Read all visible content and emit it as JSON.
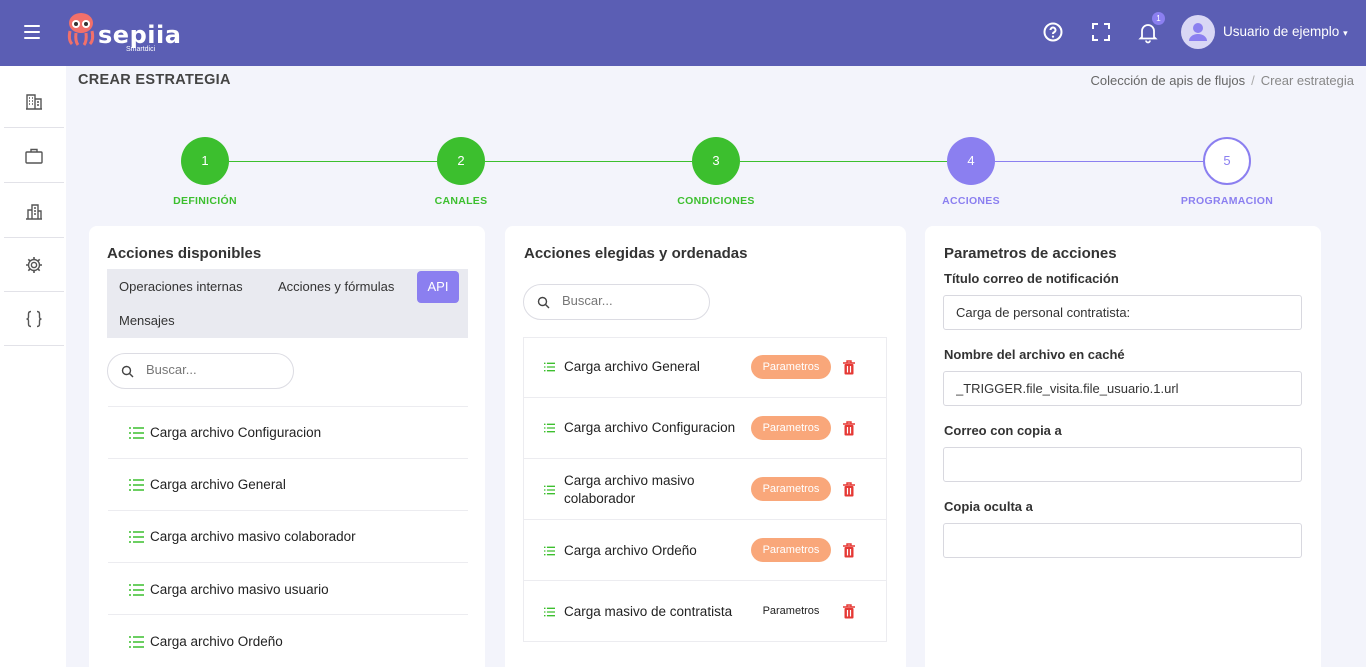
{
  "header": {
    "logo_text": "sepiia",
    "logo_subtext": "Smartdici",
    "notification_count": "1",
    "user_name": "Usuario de ejemplo"
  },
  "sidebar": {
    "items": [
      {
        "icon": "building-icon"
      },
      {
        "icon": "briefcase-icon"
      },
      {
        "icon": "city-icon"
      },
      {
        "icon": "gear-icon"
      },
      {
        "icon": "braces-icon"
      }
    ]
  },
  "page": {
    "title": "CREAR ESTRATEGIA",
    "breadcrumb": [
      "Colección de apis de flujos",
      "Crear estrategia"
    ]
  },
  "stepper": {
    "steps": [
      {
        "number": "1",
        "label": "DEFINICIÓN",
        "state": "completed"
      },
      {
        "number": "2",
        "label": "CANALES",
        "state": "completed"
      },
      {
        "number": "3",
        "label": "CONDICIONES",
        "state": "completed"
      },
      {
        "number": "4",
        "label": "ACCIONES",
        "state": "active"
      },
      {
        "number": "5",
        "label": "PROGRAMACION",
        "state": "pending"
      }
    ],
    "colors": {
      "completed": "#3cbf2e",
      "active": "#8b7ff0"
    }
  },
  "available": {
    "title": "Acciones disponibles",
    "tabs": [
      "Operaciones internas",
      "Acciones y fórmulas",
      "API",
      "Mensajes"
    ],
    "active_tab": "API",
    "search_placeholder": "Buscar...",
    "items": [
      "Carga archivo Configuracion",
      "Carga archivo General",
      "Carga archivo masivo colaborador",
      "Carga archivo masivo usuario",
      "Carga archivo Ordeño"
    ]
  },
  "chosen": {
    "title": "Acciones elegidas y ordenadas",
    "search_placeholder": "Buscar...",
    "items": [
      {
        "label": "Carga archivo General",
        "button": "Parametros"
      },
      {
        "label": "Carga archivo Configuracion",
        "button": "Parametros"
      },
      {
        "label": "Carga archivo masivo colaborador",
        "button": "Parametros"
      },
      {
        "label": "Carga archivo Ordeño",
        "button": "Parametros"
      },
      {
        "label": "Carga masivo de contratista",
        "button": "Parametros"
      }
    ]
  },
  "params": {
    "title": "Parametros de acciones",
    "fields": [
      {
        "label": "Título correo de notificación",
        "value": "Carga de personal contratista:"
      },
      {
        "label": "Nombre del archivo en caché",
        "value": "_TRIGGER.file_visita.file_usuario.1.url"
      },
      {
        "label": "Correo con copia a",
        "value": ""
      },
      {
        "label": "Copia oculta a",
        "value": ""
      }
    ]
  },
  "colors": {
    "header_bg": "#5b5eb4",
    "accent": "#8b7ff0",
    "success": "#3cbf2e",
    "param_button": "#f9a77a",
    "delete": "#e53935"
  }
}
